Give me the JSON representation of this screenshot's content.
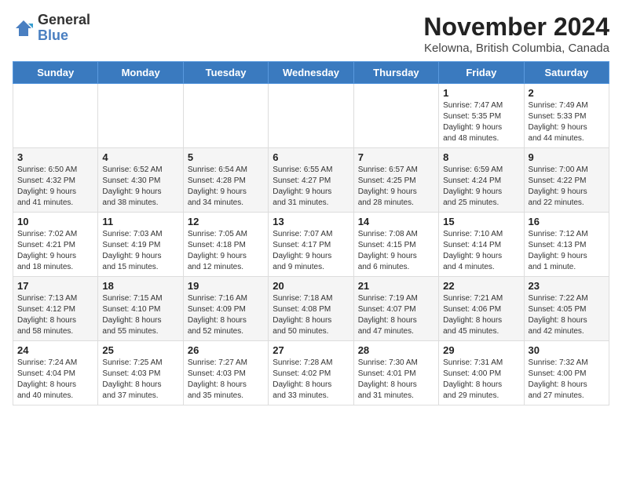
{
  "header": {
    "logo_general": "General",
    "logo_blue": "Blue",
    "month_title": "November 2024",
    "location": "Kelowna, British Columbia, Canada"
  },
  "weekdays": [
    "Sunday",
    "Monday",
    "Tuesday",
    "Wednesday",
    "Thursday",
    "Friday",
    "Saturday"
  ],
  "weeks": [
    [
      {
        "day": "",
        "info": ""
      },
      {
        "day": "",
        "info": ""
      },
      {
        "day": "",
        "info": ""
      },
      {
        "day": "",
        "info": ""
      },
      {
        "day": "",
        "info": ""
      },
      {
        "day": "1",
        "info": "Sunrise: 7:47 AM\nSunset: 5:35 PM\nDaylight: 9 hours\nand 48 minutes."
      },
      {
        "day": "2",
        "info": "Sunrise: 7:49 AM\nSunset: 5:33 PM\nDaylight: 9 hours\nand 44 minutes."
      }
    ],
    [
      {
        "day": "3",
        "info": "Sunrise: 6:50 AM\nSunset: 4:32 PM\nDaylight: 9 hours\nand 41 minutes."
      },
      {
        "day": "4",
        "info": "Sunrise: 6:52 AM\nSunset: 4:30 PM\nDaylight: 9 hours\nand 38 minutes."
      },
      {
        "day": "5",
        "info": "Sunrise: 6:54 AM\nSunset: 4:28 PM\nDaylight: 9 hours\nand 34 minutes."
      },
      {
        "day": "6",
        "info": "Sunrise: 6:55 AM\nSunset: 4:27 PM\nDaylight: 9 hours\nand 31 minutes."
      },
      {
        "day": "7",
        "info": "Sunrise: 6:57 AM\nSunset: 4:25 PM\nDaylight: 9 hours\nand 28 minutes."
      },
      {
        "day": "8",
        "info": "Sunrise: 6:59 AM\nSunset: 4:24 PM\nDaylight: 9 hours\nand 25 minutes."
      },
      {
        "day": "9",
        "info": "Sunrise: 7:00 AM\nSunset: 4:22 PM\nDaylight: 9 hours\nand 22 minutes."
      }
    ],
    [
      {
        "day": "10",
        "info": "Sunrise: 7:02 AM\nSunset: 4:21 PM\nDaylight: 9 hours\nand 18 minutes."
      },
      {
        "day": "11",
        "info": "Sunrise: 7:03 AM\nSunset: 4:19 PM\nDaylight: 9 hours\nand 15 minutes."
      },
      {
        "day": "12",
        "info": "Sunrise: 7:05 AM\nSunset: 4:18 PM\nDaylight: 9 hours\nand 12 minutes."
      },
      {
        "day": "13",
        "info": "Sunrise: 7:07 AM\nSunset: 4:17 PM\nDaylight: 9 hours\nand 9 minutes."
      },
      {
        "day": "14",
        "info": "Sunrise: 7:08 AM\nSunset: 4:15 PM\nDaylight: 9 hours\nand 6 minutes."
      },
      {
        "day": "15",
        "info": "Sunrise: 7:10 AM\nSunset: 4:14 PM\nDaylight: 9 hours\nand 4 minutes."
      },
      {
        "day": "16",
        "info": "Sunrise: 7:12 AM\nSunset: 4:13 PM\nDaylight: 9 hours\nand 1 minute."
      }
    ],
    [
      {
        "day": "17",
        "info": "Sunrise: 7:13 AM\nSunset: 4:12 PM\nDaylight: 8 hours\nand 58 minutes."
      },
      {
        "day": "18",
        "info": "Sunrise: 7:15 AM\nSunset: 4:10 PM\nDaylight: 8 hours\nand 55 minutes."
      },
      {
        "day": "19",
        "info": "Sunrise: 7:16 AM\nSunset: 4:09 PM\nDaylight: 8 hours\nand 52 minutes."
      },
      {
        "day": "20",
        "info": "Sunrise: 7:18 AM\nSunset: 4:08 PM\nDaylight: 8 hours\nand 50 minutes."
      },
      {
        "day": "21",
        "info": "Sunrise: 7:19 AM\nSunset: 4:07 PM\nDaylight: 8 hours\nand 47 minutes."
      },
      {
        "day": "22",
        "info": "Sunrise: 7:21 AM\nSunset: 4:06 PM\nDaylight: 8 hours\nand 45 minutes."
      },
      {
        "day": "23",
        "info": "Sunrise: 7:22 AM\nSunset: 4:05 PM\nDaylight: 8 hours\nand 42 minutes."
      }
    ],
    [
      {
        "day": "24",
        "info": "Sunrise: 7:24 AM\nSunset: 4:04 PM\nDaylight: 8 hours\nand 40 minutes."
      },
      {
        "day": "25",
        "info": "Sunrise: 7:25 AM\nSunset: 4:03 PM\nDaylight: 8 hours\nand 37 minutes."
      },
      {
        "day": "26",
        "info": "Sunrise: 7:27 AM\nSunset: 4:03 PM\nDaylight: 8 hours\nand 35 minutes."
      },
      {
        "day": "27",
        "info": "Sunrise: 7:28 AM\nSunset: 4:02 PM\nDaylight: 8 hours\nand 33 minutes."
      },
      {
        "day": "28",
        "info": "Sunrise: 7:30 AM\nSunset: 4:01 PM\nDaylight: 8 hours\nand 31 minutes."
      },
      {
        "day": "29",
        "info": "Sunrise: 7:31 AM\nSunset: 4:00 PM\nDaylight: 8 hours\nand 29 minutes."
      },
      {
        "day": "30",
        "info": "Sunrise: 7:32 AM\nSunset: 4:00 PM\nDaylight: 8 hours\nand 27 minutes."
      }
    ]
  ]
}
